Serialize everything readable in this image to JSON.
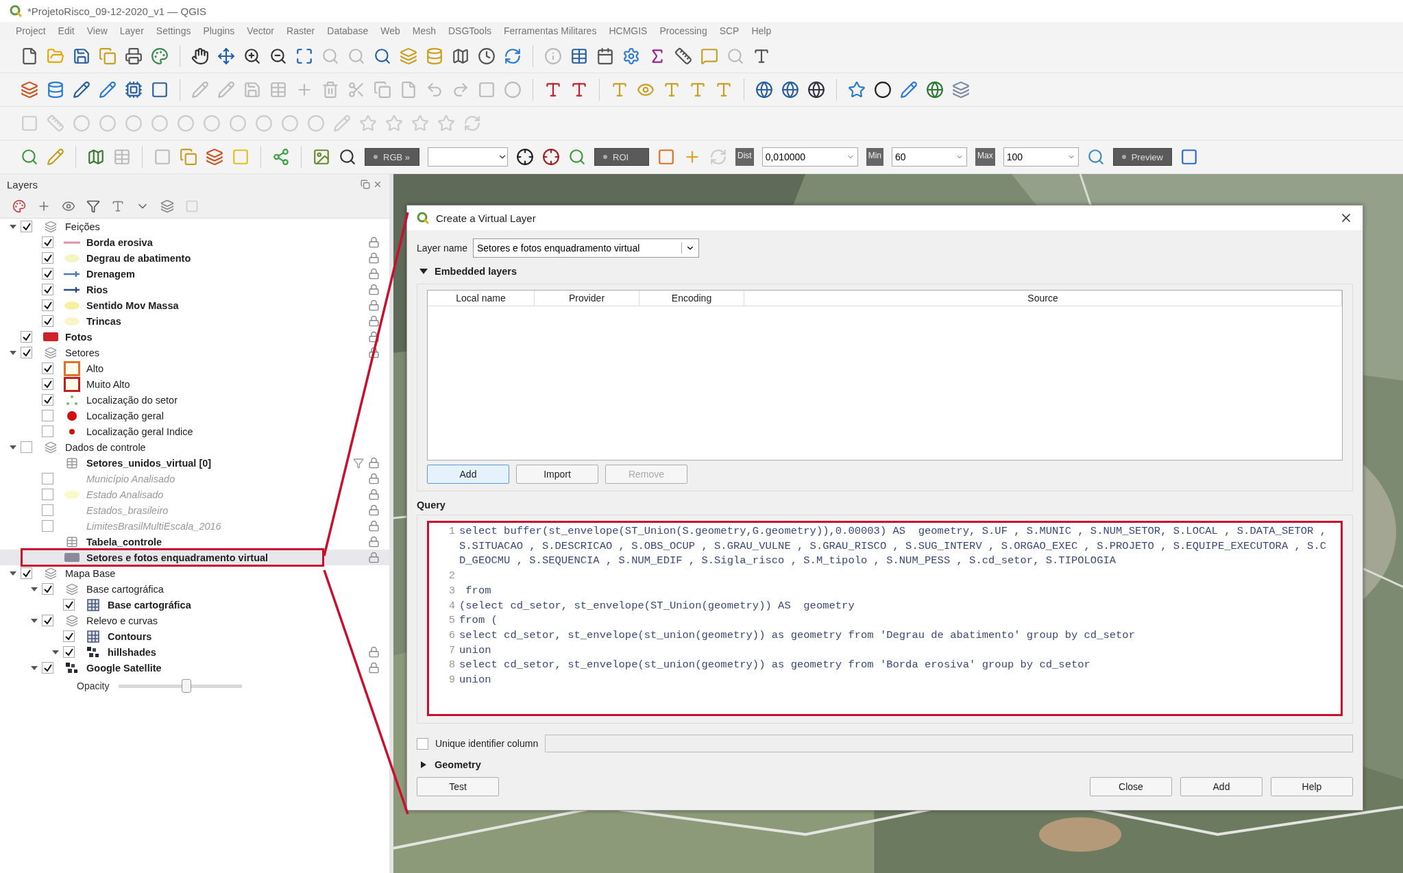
{
  "window": {
    "title": "*ProjetoRisco_09-12-2020_v1 — QGIS"
  },
  "menu": [
    "Project",
    "Edit",
    "View",
    "Layer",
    "Settings",
    "Plugins",
    "Vector",
    "Raster",
    "Database",
    "Web",
    "Mesh",
    "DSGTools",
    "Ferramentas Militares",
    "HCMGIS",
    "Processing",
    "SCP",
    "Help"
  ],
  "toolbar_controls": {
    "rgb_button": "RGB »",
    "roi_button": "ROI",
    "dist": {
      "label": "Dist",
      "value": "0,010000"
    },
    "min": {
      "label": "Min",
      "value": "60"
    },
    "max": {
      "label": "Max",
      "value": "100"
    },
    "preview_button": "Preview"
  },
  "layers_panel": {
    "title": "Layers",
    "tree": [
      {
        "label": "Feições",
        "kind": "group",
        "checked": true,
        "expanded": true,
        "locked": false,
        "selected": false,
        "symbol": {
          "kind": "group"
        },
        "children": [
          {
            "label": "Borda erosiva",
            "kind": "layer",
            "checked": true,
            "locked": true,
            "selected": false,
            "symbol": {
              "kind": "line",
              "color": "#e090a8"
            }
          },
          {
            "label": "Degrau de abatimento",
            "kind": "layer",
            "checked": true,
            "locked": true,
            "selected": false,
            "symbol": {
              "kind": "ellipse",
              "color": "#f4f4c4"
            }
          },
          {
            "label": "Drenagem",
            "kind": "layer",
            "checked": true,
            "locked": true,
            "selected": false,
            "symbol": {
              "kind": "arrow",
              "color": "#4a7ab8"
            }
          },
          {
            "label": "Rios",
            "kind": "layer",
            "checked": true,
            "locked": true,
            "selected": false,
            "symbol": {
              "kind": "arrow",
              "color": "#2a4a8a"
            }
          },
          {
            "label": "Sentido Mov Massa",
            "kind": "layer",
            "checked": true,
            "locked": true,
            "selected": false,
            "symbol": {
              "kind": "ellipse",
              "color": "#f6f0a0"
            }
          },
          {
            "label": "Trincas",
            "kind": "layer",
            "checked": true,
            "locked": true,
            "selected": false,
            "symbol": {
              "kind": "ellipse",
              "color": "#f8f4cc"
            }
          }
        ]
      },
      {
        "label": "Fotos",
        "kind": "layer",
        "checked": true,
        "locked": true,
        "selected": false,
        "symbol": {
          "kind": "swatch",
          "color": "#d0202a"
        }
      },
      {
        "label": "Setores",
        "kind": "group",
        "checked": true,
        "expanded": true,
        "locked": true,
        "selected": false,
        "symbol": {
          "kind": "group"
        },
        "children": [
          {
            "label": "Alto",
            "kind": "category",
            "checked": true,
            "locked": false,
            "selected": false,
            "symbol": {
              "kind": "outline",
              "color": "#e07030"
            }
          },
          {
            "label": "Muito Alto",
            "kind": "category",
            "checked": true,
            "locked": false,
            "selected": false,
            "symbol": {
              "kind": "outline",
              "color": "#c02020"
            }
          },
          {
            "label": "Localização do setor",
            "kind": "category",
            "checked": true,
            "locked": false,
            "selected": false,
            "symbol": {
              "kind": "points",
              "color": "#70c070"
            }
          },
          {
            "label": "Localização geral",
            "kind": "category",
            "checked": false,
            "locked": false,
            "selected": false,
            "symbol": {
              "kind": "dot",
              "color": "#d01010"
            }
          },
          {
            "label": "Localização geral Indice",
            "kind": "category",
            "checked": false,
            "locked": false,
            "selected": false,
            "symbol": {
              "kind": "smalldot",
              "color": "#d01010"
            }
          }
        ]
      },
      {
        "label": "Dados de controle",
        "kind": "group",
        "checked": false,
        "expanded": true,
        "locked": false,
        "selected": false,
        "symbol": {
          "kind": "group"
        },
        "children": [
          {
            "label": "Setores_unidos_virtual [0]",
            "kind": "table",
            "locked": true,
            "filtered": true,
            "selected": false,
            "symbol": {
              "kind": "table"
            }
          },
          {
            "label": "Município Analisado",
            "kind": "out_of_scale",
            "checked": false,
            "locked": true,
            "selected": false
          },
          {
            "label": "Estado Analisado",
            "kind": "out_of_scale",
            "checked": false,
            "locked": true,
            "selected": false,
            "symbol": {
              "kind": "ellipse",
              "color": "#fafac8"
            }
          },
          {
            "label": "Estados_brasileiro",
            "kind": "out_of_scale",
            "checked": false,
            "locked": true,
            "selected": false
          },
          {
            "label": "LimitesBrasilMultiEscala_2016",
            "kind": "out_of_scale",
            "checked": false,
            "locked": true,
            "selected": false
          },
          {
            "label": "Tabela_controle",
            "kind": "table",
            "locked": true,
            "filtered": false,
            "selected": false,
            "symbol": {
              "kind": "table"
            }
          },
          {
            "label": "Setores e fotos enquadramento virtual",
            "kind": "table",
            "locked": true,
            "filtered": false,
            "selected": true,
            "symbol": {
              "kind": "swatch",
              "color": "#8a8a9a"
            }
          }
        ]
      },
      {
        "label": "Mapa Base",
        "kind": "group",
        "checked": true,
        "expanded": true,
        "locked": false,
        "selected": false,
        "symbol": {
          "kind": "group"
        },
        "children": [
          {
            "label": "Base cartográfica",
            "kind": "group",
            "checked": true,
            "expanded": true,
            "locked": false,
            "selected": false,
            "symbol": {
              "kind": "group"
            },
            "children": [
              {
                "label": "Base cartográfica",
                "kind": "layer",
                "checked": true,
                "locked": false,
                "selected": false,
                "symbol": {
                  "kind": "grid"
                }
              }
            ]
          },
          {
            "label": "Relevo e curvas",
            "kind": "group",
            "checked": true,
            "expanded": true,
            "locked": false,
            "selected": false,
            "symbol": {
              "kind": "group"
            },
            "children": [
              {
                "label": "Contours",
                "kind": "layer",
                "checked": true,
                "locked": false,
                "selected": false,
                "symbol": {
                  "kind": "grid"
                }
              },
              {
                "label": "hillshades",
                "kind": "layer",
                "checked": true,
                "expanded": true,
                "locked": true,
                "selected": false,
                "symbol": {
                  "kind": "tiles"
                }
              }
            ]
          },
          {
            "label": "Google Satellite",
            "kind": "layer",
            "checked": true,
            "expanded": true,
            "locked": true,
            "selected": false,
            "symbol": {
              "kind": "tiles"
            },
            "opacity": {
              "label": "Opacity",
              "level": 0.55
            }
          }
        ]
      }
    ]
  },
  "dialog": {
    "title": "Create a Virtual Layer",
    "layer_name": {
      "label": "Layer name",
      "value": "Setores e fotos enquadramento virtual"
    },
    "embedded_layers": {
      "title": "Embedded layers",
      "expanded": true,
      "columns": [
        "Local name",
        "Provider",
        "Encoding",
        "Source"
      ],
      "buttons": [
        {
          "label": "Add",
          "disabled": false,
          "focused": true
        },
        {
          "label": "Import",
          "disabled": false,
          "focused": false
        },
        {
          "label": "Remove",
          "disabled": true,
          "focused": false
        }
      ]
    },
    "query": {
      "label": "Query",
      "lines": [
        {
          "number": "1",
          "text": "select buffer(st_envelope(ST_Union(S.geometry,G.geometry)),0.00003) AS  geometry, S.UF , S.MUNIC , S.NUM_SETOR, S.LOCAL , S.DATA_SETOR ,  S.SITUACAO , S.DESCRICAO , S.OBS_OCUP , S.GRAU_VULNE , S.GRAU_RISCO , S.SUG_INTERV , S.ORGAO_EXEC , S.PROJETO , S.EQUIPE_EXECUTORA , S.CD_GEOCMU , S.SEQUENCIA , S.NUM_EDIF , S.Sigla_risco , S.M_tipolo , S.NUM_PESS , S.cd_setor, S.TIPOLOGIA"
        },
        {
          "number": "2"
        },
        {
          "number": "3",
          "text": " from"
        },
        {
          "number": "4",
          "text": "(select cd_setor, st_envelope(ST_Union(geometry)) AS  geometry"
        },
        {
          "number": "5",
          "text": "from ("
        },
        {
          "number": "6",
          "text": "select cd_setor, st_envelope(st_union(geometry)) as geometry from 'Degrau de abatimento' group by cd_setor"
        },
        {
          "number": "7",
          "text": "union"
        },
        {
          "number": "8",
          "text": "select cd_setor, st_envelope(st_union(geometry)) as geometry from 'Borda erosiva' group by cd_setor"
        },
        {
          "number": "9",
          "text": "union"
        }
      ]
    },
    "unique_identifier": {
      "label": "Unique identifier column",
      "checked": false
    },
    "geometry": {
      "title": "Geometry",
      "expanded": false
    },
    "buttons": [
      {
        "label": "Test",
        "kind": "left"
      },
      {
        "label": "Close",
        "kind": "right"
      },
      {
        "label": "Add",
        "kind": "right"
      },
      {
        "label": "Help",
        "kind": "right"
      }
    ]
  }
}
